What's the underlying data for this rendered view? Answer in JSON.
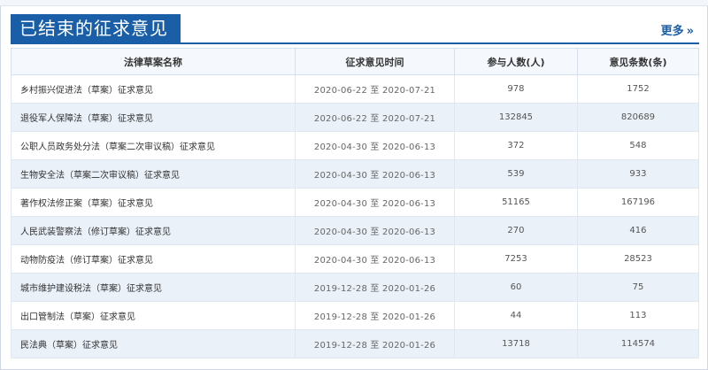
{
  "header": {
    "title": "已结束的征求意见",
    "more_label": "更多",
    "more_icon": "double-chevron-right"
  },
  "table": {
    "columns": [
      "法律草案名称",
      "征求意见时间",
      "参与人数(人)",
      "意见条数(条)"
    ],
    "rows": [
      {
        "name": "乡村振兴促进法（草案）征求意见",
        "period": "2020-06-22 至 2020-07-21",
        "people": "978",
        "count": "1752"
      },
      {
        "name": "退役军人保障法（草案）征求意见",
        "period": "2020-06-22 至 2020-07-21",
        "people": "132845",
        "count": "820689"
      },
      {
        "name": "公职人员政务处分法（草案二次审议稿）征求意见",
        "period": "2020-04-30 至 2020-06-13",
        "people": "372",
        "count": "548"
      },
      {
        "name": "生物安全法（草案二次审议稿）征求意见",
        "period": "2020-04-30 至 2020-06-13",
        "people": "539",
        "count": "933"
      },
      {
        "name": "著作权法修正案（草案）征求意见",
        "period": "2020-04-30 至 2020-06-13",
        "people": "51165",
        "count": "167196"
      },
      {
        "name": "人民武装警察法（修订草案）征求意见",
        "period": "2020-04-30 至 2020-06-13",
        "people": "270",
        "count": "416"
      },
      {
        "name": "动物防疫法（修订草案）征求意见",
        "period": "2020-04-30 至 2020-06-13",
        "people": "7253",
        "count": "28523"
      },
      {
        "name": "城市维护建设税法（草案）征求意见",
        "period": "2019-12-28 至 2020-01-26",
        "people": "60",
        "count": "75"
      },
      {
        "name": "出口管制法（草案）征求意见",
        "period": "2019-12-28 至 2020-01-26",
        "people": "44",
        "count": "113"
      },
      {
        "name": "民法典（草案）征求意见",
        "period": "2019-12-28 至 2020-01-26",
        "people": "13718",
        "count": "114574"
      }
    ]
  },
  "colors": {
    "accent": "#1b5ea8",
    "row_alt": "#eaf1f8",
    "header_bg": "#f5f8fc"
  }
}
